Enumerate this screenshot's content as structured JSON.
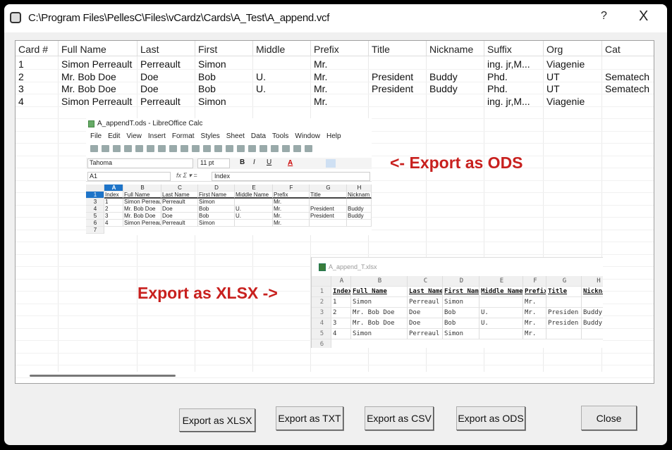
{
  "window": {
    "title": "C:\\Program Files\\PellesC\\Files\\vCardz\\Cards\\A_Test\\A_append.vcf",
    "help": "?",
    "close": "X"
  },
  "list": {
    "columns": [
      "Card #",
      "Full Name",
      "Last",
      "First",
      "Middle",
      "Prefix",
      "Title",
      "Nickname",
      "Suffix",
      "Org",
      "Cat"
    ],
    "rows": [
      [
        "1",
        "Simon Perreault",
        "Perreault",
        "Simon",
        "",
        "Mr.",
        "",
        "",
        "ing. jr,M...",
        "Viagenie",
        ""
      ],
      [
        "2",
        "Mr. Bob Doe",
        "Doe",
        "Bob",
        "U.",
        "Mr.",
        "President",
        "Buddy",
        "Phd.",
        "UT",
        "Sematech"
      ],
      [
        "3",
        "Mr. Bob Doe",
        "Doe",
        "Bob",
        "U.",
        "Mr.",
        "President",
        "Buddy",
        "Phd.",
        "UT",
        "Sematech"
      ],
      [
        "4",
        "Simon Perreault",
        "Perreault",
        "Simon",
        "",
        "Mr.",
        "",
        "",
        "ing. jr,M...",
        "Viagenie",
        ""
      ]
    ]
  },
  "annotations": {
    "ods": "<- Export as ODS",
    "xlsx": "Export as XLSX ->"
  },
  "libreoffice": {
    "title": "A_appendT.ods - LibreOffice Calc",
    "menu": [
      "File",
      "Edit",
      "View",
      "Insert",
      "Format",
      "Styles",
      "Sheet",
      "Data",
      "Tools",
      "Window",
      "Help"
    ],
    "font": "Tahoma",
    "size": "11 pt",
    "bold": "B",
    "italic": "I",
    "underline": "U",
    "cell_ref": "A1",
    "formula": "Index",
    "col_letters": [
      "A",
      "B",
      "C",
      "D",
      "E",
      "F",
      "G",
      "H"
    ],
    "row_numbers": [
      "1",
      "3",
      "4",
      "5",
      "6",
      "7"
    ],
    "rows": [
      [
        "Index",
        "Full Name",
        "Last Name",
        "First Name",
        "Middle Name",
        "Prefix",
        "Title",
        "Nicknam"
      ],
      [
        "1",
        "Simon Perreault",
        "Perreault",
        "Simon",
        "",
        "Mr.",
        "",
        ""
      ],
      [
        "2",
        "Mr. Bob Doe",
        "Doe",
        "Bob",
        "U.",
        "Mr.",
        "President",
        "Buddy"
      ],
      [
        "3",
        "Mr. Bob Doe",
        "Doe",
        "Bob",
        "U.",
        "Mr.",
        "President",
        "Buddy"
      ],
      [
        "4",
        "Simon Perreault",
        "Perreault",
        "Simon",
        "",
        "Mr.",
        "",
        ""
      ]
    ]
  },
  "excel": {
    "title": "A_append_T.xlsx",
    "col_letters": [
      "A",
      "B",
      "C",
      "D",
      "E",
      "F",
      "G",
      "H"
    ],
    "row_numbers": [
      "1",
      "2",
      "3",
      "4",
      "5",
      "6"
    ],
    "rows": [
      [
        "Index",
        "Full Name",
        "Last Name",
        "First Name",
        "Middle Name",
        "Prefix",
        "Title",
        "Nickname"
      ],
      [
        "1",
        "Simon",
        "Perreaul",
        "Simon",
        "",
        "Mr.",
        "",
        ""
      ],
      [
        "2",
        "Mr. Bob Doe",
        "Doe",
        "Bob",
        "U.",
        "Mr.",
        "Presiden",
        "Buddy"
      ],
      [
        "3",
        "Mr. Bob Doe",
        "Doe",
        "Bob",
        "U.",
        "Mr.",
        "Presiden",
        "Buddy"
      ],
      [
        "4",
        "Simon",
        "Perreaul",
        "Simon",
        "",
        "Mr.",
        "",
        ""
      ]
    ]
  },
  "buttons": {
    "xlsx": "Export as XLSX",
    "txt": "Export as TXT",
    "csv": "Export as CSV",
    "ods": "Export as ODS",
    "close": "Close"
  },
  "colors": {
    "annotation": "#c8201e",
    "lo_selected": "#1e74c8"
  }
}
